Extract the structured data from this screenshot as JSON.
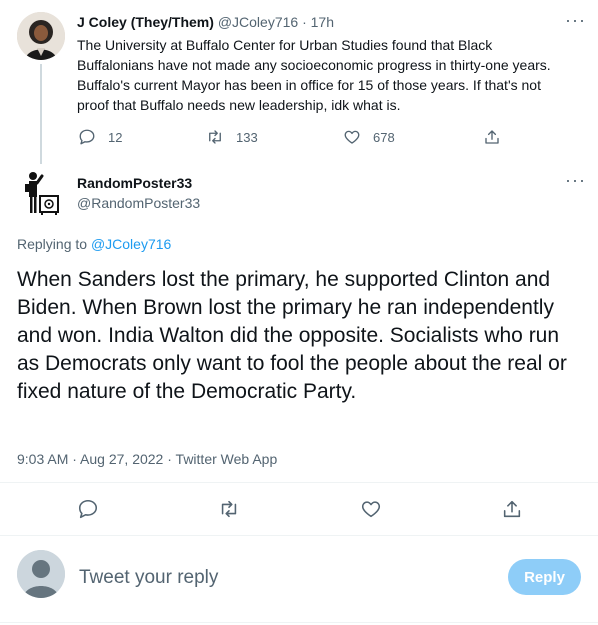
{
  "parent_tweet": {
    "display_name": "J Coley (They/Them)",
    "handle": "@JColey716",
    "time_separator": "·",
    "time": "17h",
    "more": "···",
    "text": "The University at Buffalo Center for Urban Studies found that Black Buffalonians have not made any socioeconomic progress in thirty-one years. Buffalo's current Mayor has been in office for 15 of those years. If that's not proof that Buffalo needs new leadership, idk what is.",
    "replies": "12",
    "retweets": "133",
    "likes": "678"
  },
  "main_tweet": {
    "display_name": "RandomPoster33",
    "handle": "@RandomPoster33",
    "more": "···",
    "replying_prefix": "Replying to ",
    "replying_handle": "@JColey716",
    "text": "When Sanders lost the primary, he supported Clinton and Biden. When Brown lost the primary he ran independently and won. India Walton did the opposite. Socialists who run as Democrats only want to fool the people about the real or fixed nature of the Democratic Party.",
    "time": "9:03 AM",
    "date": "Aug 27, 2022",
    "source": "Twitter Web App",
    "meta_separator": " · "
  },
  "reply_box": {
    "placeholder": "Tweet your reply",
    "button_label": "Reply"
  },
  "colors": {
    "link": "#1d9bf0",
    "muted": "#536471",
    "reply_button_disabled": "#8ecdf8"
  },
  "icons": [
    "reply-icon",
    "retweet-icon",
    "like-icon",
    "share-icon",
    "more-icon"
  ]
}
